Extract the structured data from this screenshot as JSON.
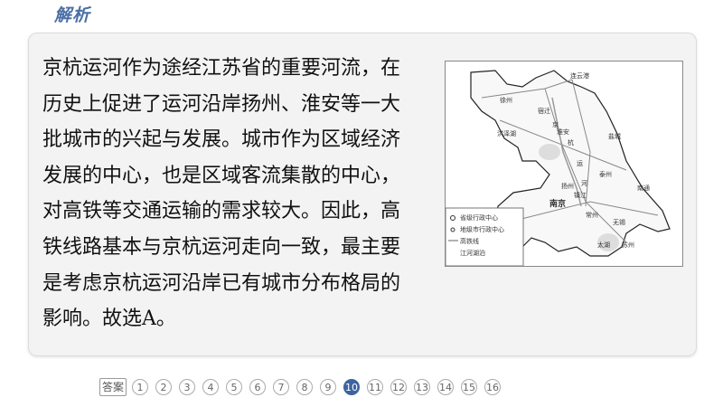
{
  "section_title": "解析",
  "lines": [
    "京杭运河作为途经江苏省的重要河流，在",
    "历史上促进了运河沿岸扬州、淮安等一大",
    "批城市的兴起与发展。城市作为区域经济",
    "发展的中心，也是区域客流集散的中心，",
    "对高铁等交通运输的需求较大。因此，高",
    "铁线路基本与京杭运河走向一致，最主要",
    "是考虑京杭运河沿岸已有城市分布格局的",
    "影响。故选A。"
  ],
  "map": {
    "cities": [
      "连云港",
      "徐州",
      "宿迁",
      "淮安",
      "盐城",
      "扬州",
      "泰州",
      "镇江",
      "南京",
      "常州",
      "无锡",
      "苏州",
      "南通"
    ],
    "features": [
      "洪泽湖",
      "太湖",
      "京",
      "杭",
      "运",
      "河"
    ],
    "legend": [
      "省级行政中心",
      "地级市行政中心",
      "高铁线",
      "江河湖泊"
    ]
  },
  "pager": {
    "answer_label": "答案",
    "pages": [
      "1",
      "2",
      "3",
      "4",
      "5",
      "6",
      "7",
      "8",
      "9",
      "10",
      "11",
      "12",
      "13",
      "14",
      "15",
      "16"
    ],
    "active": "10"
  },
  "colors": {
    "accent": "#3e64a0",
    "title": "#4a6fa5"
  }
}
